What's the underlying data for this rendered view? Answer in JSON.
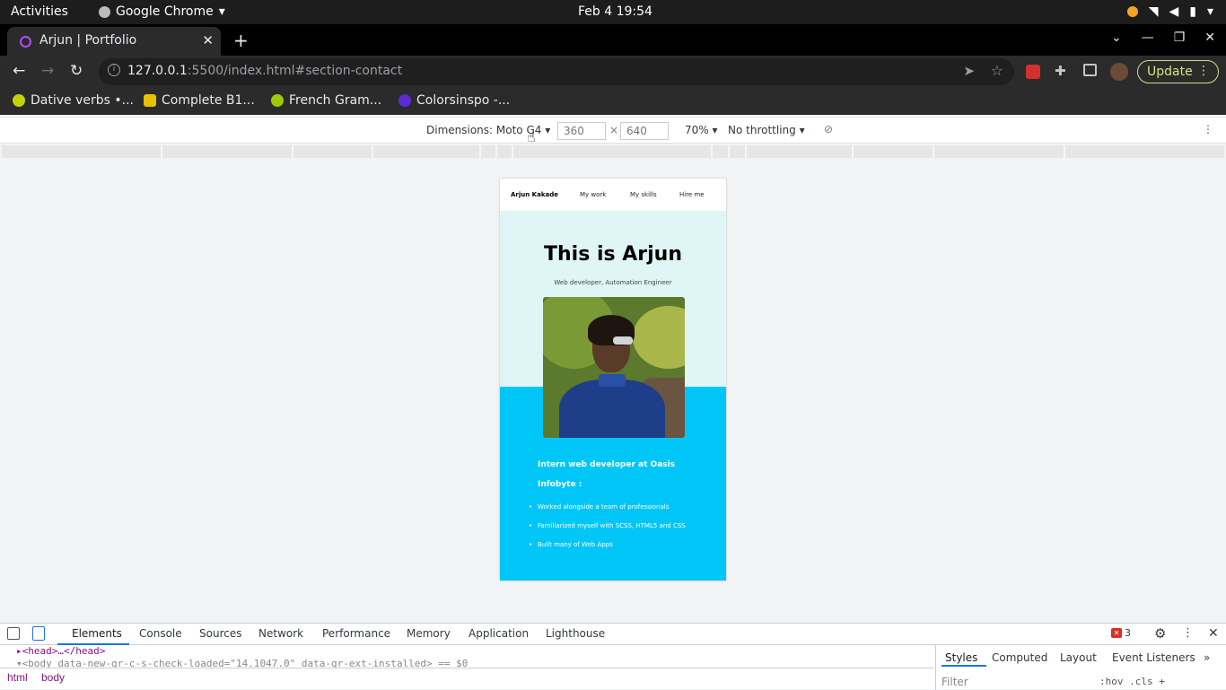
{
  "system": {
    "activities": "Activities",
    "app_name": "Google Chrome",
    "clock": "Feb 4  19:54"
  },
  "browser": {
    "tab_title": "Arjun | Portfolio",
    "url_host": "127.0.0.1",
    "url_path": ":5500/index.html#section-contact",
    "update_label": "Update",
    "bookmarks": [
      {
        "label": "Dative verbs •...",
        "color": "#c6d200"
      },
      {
        "label": "Complete B1...",
        "color": "#e8c200"
      },
      {
        "label": "French Gram...",
        "color": "#9ccc00"
      },
      {
        "label": "Colorsinspo -...",
        "color": "#5b2bd6"
      }
    ]
  },
  "device_toolbar": {
    "dimensions_label": "Dimensions: Moto G4 ▾",
    "width": "360",
    "height": "640",
    "times": "×",
    "zoom": "70% ▾",
    "throttle": "No throttling ▾"
  },
  "portfolio": {
    "nav": {
      "brand": "Arjun Kakade",
      "links": [
        "My work",
        "My skills",
        "Hire me"
      ]
    },
    "hero_title": "This is Arjun",
    "hero_subtitle": "Web developer, Automation Engineer",
    "job_title": "Intern web developer at Oasis Infobyte :",
    "job_points": [
      "Worked alongside a team of professionals",
      "Familiarized myself with SCSS, HTML5 and CSS",
      "Built many of Web Apps"
    ]
  },
  "devtools": {
    "tabs": [
      "Elements",
      "Console",
      "Sources",
      "Network",
      "Performance",
      "Memory",
      "Application",
      "Lighthouse"
    ],
    "error_count": "3",
    "head_line": "▸<head>…</head>",
    "body_line": "▾<body data-new-gr-c-s-check-loaded=\"14.1047.0\" data-gr-ext-installed> == $0",
    "breadcrumbs": [
      "html",
      "body"
    ],
    "side_tabs": [
      "Styles",
      "Computed",
      "Layout",
      "Event Listeners",
      "»"
    ],
    "filter_placeholder": "Filter",
    "hov_cls": ":hov  .cls  +"
  }
}
